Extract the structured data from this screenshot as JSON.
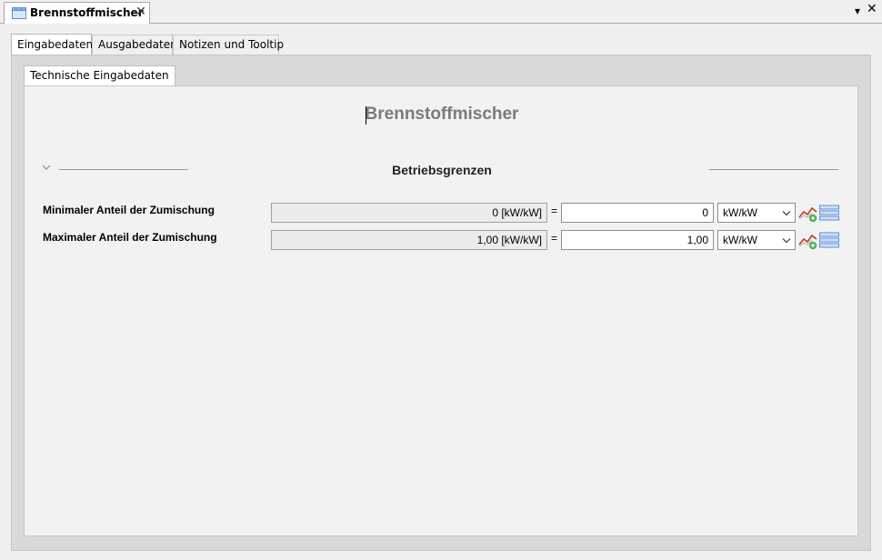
{
  "document_tab": {
    "title": "Brennstoffmischer",
    "close_glyph": "✕",
    "icon": "window-icon"
  },
  "window_controls": {
    "menu_glyph": "▾",
    "close_glyph": "✕"
  },
  "main_tabs": [
    {
      "label": "Eingabedaten",
      "active": true
    },
    {
      "label": "Ausgabedaten",
      "active": false
    },
    {
      "label": "Notizen und Tooltip",
      "active": false
    }
  ],
  "sub_tab": {
    "label": "Technische Eingabedaten"
  },
  "content": {
    "title": "Brennstoffmischer",
    "section": {
      "title": "Betriebsgrenzen",
      "expanded": true
    },
    "rows": [
      {
        "label": "Minimaler Anteil der Zumischung",
        "calculated": "0 [kW/kW]",
        "equals": "=",
        "value": "0",
        "unit": "kW/kW"
      },
      {
        "label": "Maximaler Anteil der Zumischung",
        "calculated": "1,00 [kW/kW]",
        "equals": "=",
        "value": "1,00",
        "unit": "kW/kW"
      }
    ]
  },
  "colors": {
    "title_gray": "#7a7a7a",
    "panel_bg": "#d9d9d9",
    "content_bg": "#f2f2f2",
    "icon_blue": "#5b8fd6",
    "chart_red": "#c0392b",
    "chart_green": "#4caf50"
  }
}
